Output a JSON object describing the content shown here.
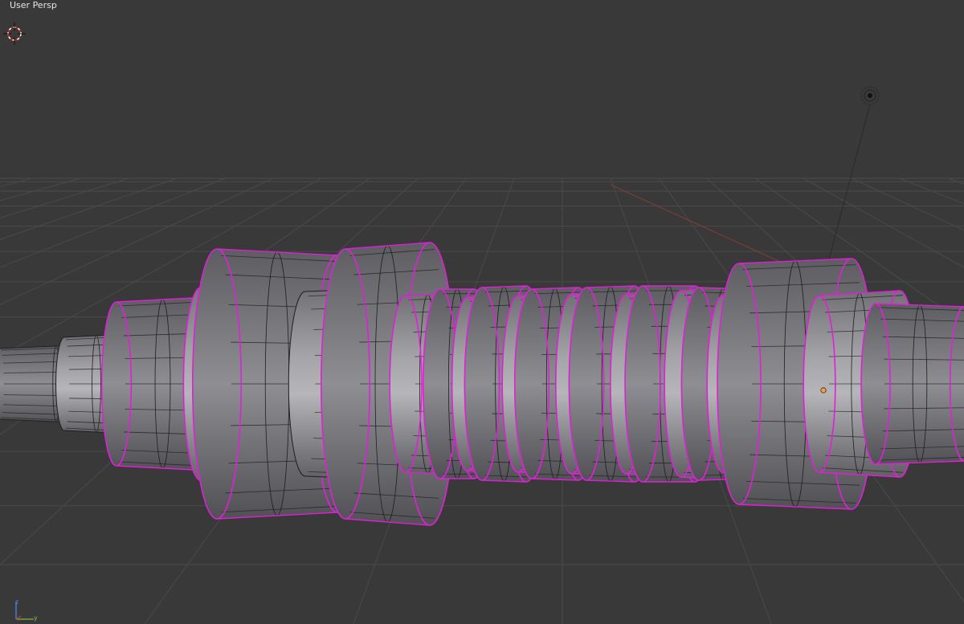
{
  "viewport": {
    "view_label": "User Persp",
    "background_color": "#393939",
    "grid_color": "#4a4a4a",
    "x_axis_color": "#a3453e",
    "y_axis_color": "#6fa63a",
    "z_axis_color": "#4f74cf",
    "mesh_fill": "#8b8b8f",
    "mesh_edge": "#1f1f1f",
    "selected_edge_color": "#e020d8",
    "origin_dot_color": "#f0a050"
  },
  "icons": {
    "cursor": "3d-cursor-icon",
    "lamp": "lamp-icon",
    "axis_gizmo": "axis-gizmo-icon"
  },
  "gizmo": {
    "z_label": "z",
    "y_label": "y"
  }
}
